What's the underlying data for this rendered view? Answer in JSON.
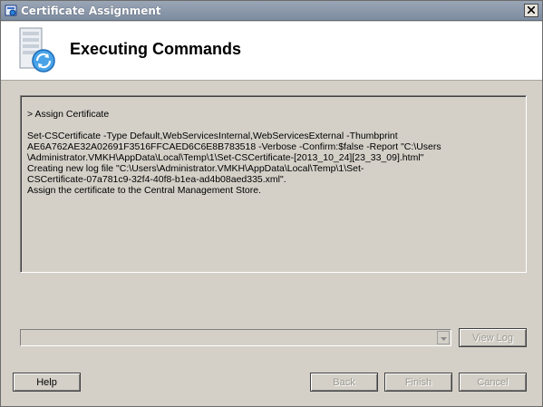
{
  "window": {
    "title": "Certificate Assignment"
  },
  "header": {
    "title": "Executing Commands"
  },
  "output": {
    "lines": [
      "> Assign Certificate",
      "",
      "Set-CSCertificate -Type Default,WebServicesInternal,WebServicesExternal -Thumbprint",
      "AE6A762AE32A02691F3516FFCAED6C6E8B783518 -Verbose -Confirm:$false -Report \"C:\\Users",
      "\\Administrator.VMKH\\AppData\\Local\\Temp\\1\\Set-CSCertificate-[2013_10_24][23_33_09].html\"",
      "Creating new log file \"C:\\Users\\Administrator.VMKH\\AppData\\Local\\Temp\\1\\Set-",
      "CSCertificate-07a781c9-32f4-40f8-b1ea-ad4b08aed335.xml\".",
      "Assign the certificate to the Central Management Store."
    ]
  },
  "log": {
    "selected": ""
  },
  "buttons": {
    "view_log": "View Log",
    "help": "Help",
    "back": "Back",
    "finish": "Finish",
    "cancel": "Cancel"
  }
}
